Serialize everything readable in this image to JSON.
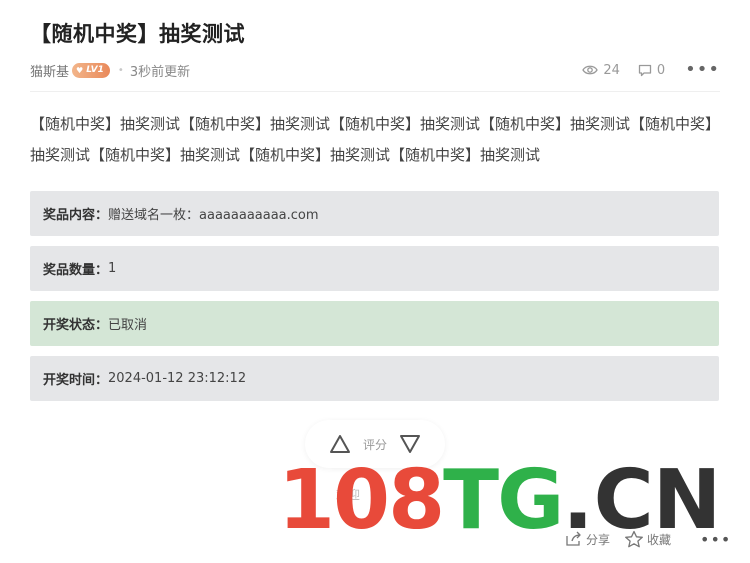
{
  "post": {
    "title": "【随机中奖】抽奖测试",
    "author": "猫斯基",
    "level_badge": "LV1",
    "updated": "3秒前更新",
    "views": "24",
    "comments": "0",
    "more": "•••",
    "content": "【随机中奖】抽奖测试【随机中奖】抽奖测试【随机中奖】抽奖测试【随机中奖】抽奖测试【随机中奖】抽奖测试【随机中奖】抽奖测试【随机中奖】抽奖测试【随机中奖】抽奖测试"
  },
  "lottery": {
    "prize_label": "奖品内容：",
    "prize_value": "赠送域名一枚：aaaaaaaaaaa.com",
    "count_label": "奖品数量：",
    "count_value": "1",
    "status_label": "开奖状态：",
    "status_value": "已取消",
    "time_label": "开奖时间：",
    "time_value": "2024-01-12 23:12:12"
  },
  "rating": {
    "label": "评分"
  },
  "faint_label": "欢迎",
  "actions": {
    "share": "分享",
    "favorite": "收藏",
    "more": "•••"
  },
  "watermark": {
    "num": "108",
    "tg": "TG",
    "dot": ".",
    "cn": "CN"
  },
  "colors": {
    "status_ok_bg": "#d4e6d6",
    "info_bg": "#e5e6e8",
    "badge": "#e9895a",
    "wm_red": "#e84a3a",
    "wm_green": "#2fb14a"
  }
}
